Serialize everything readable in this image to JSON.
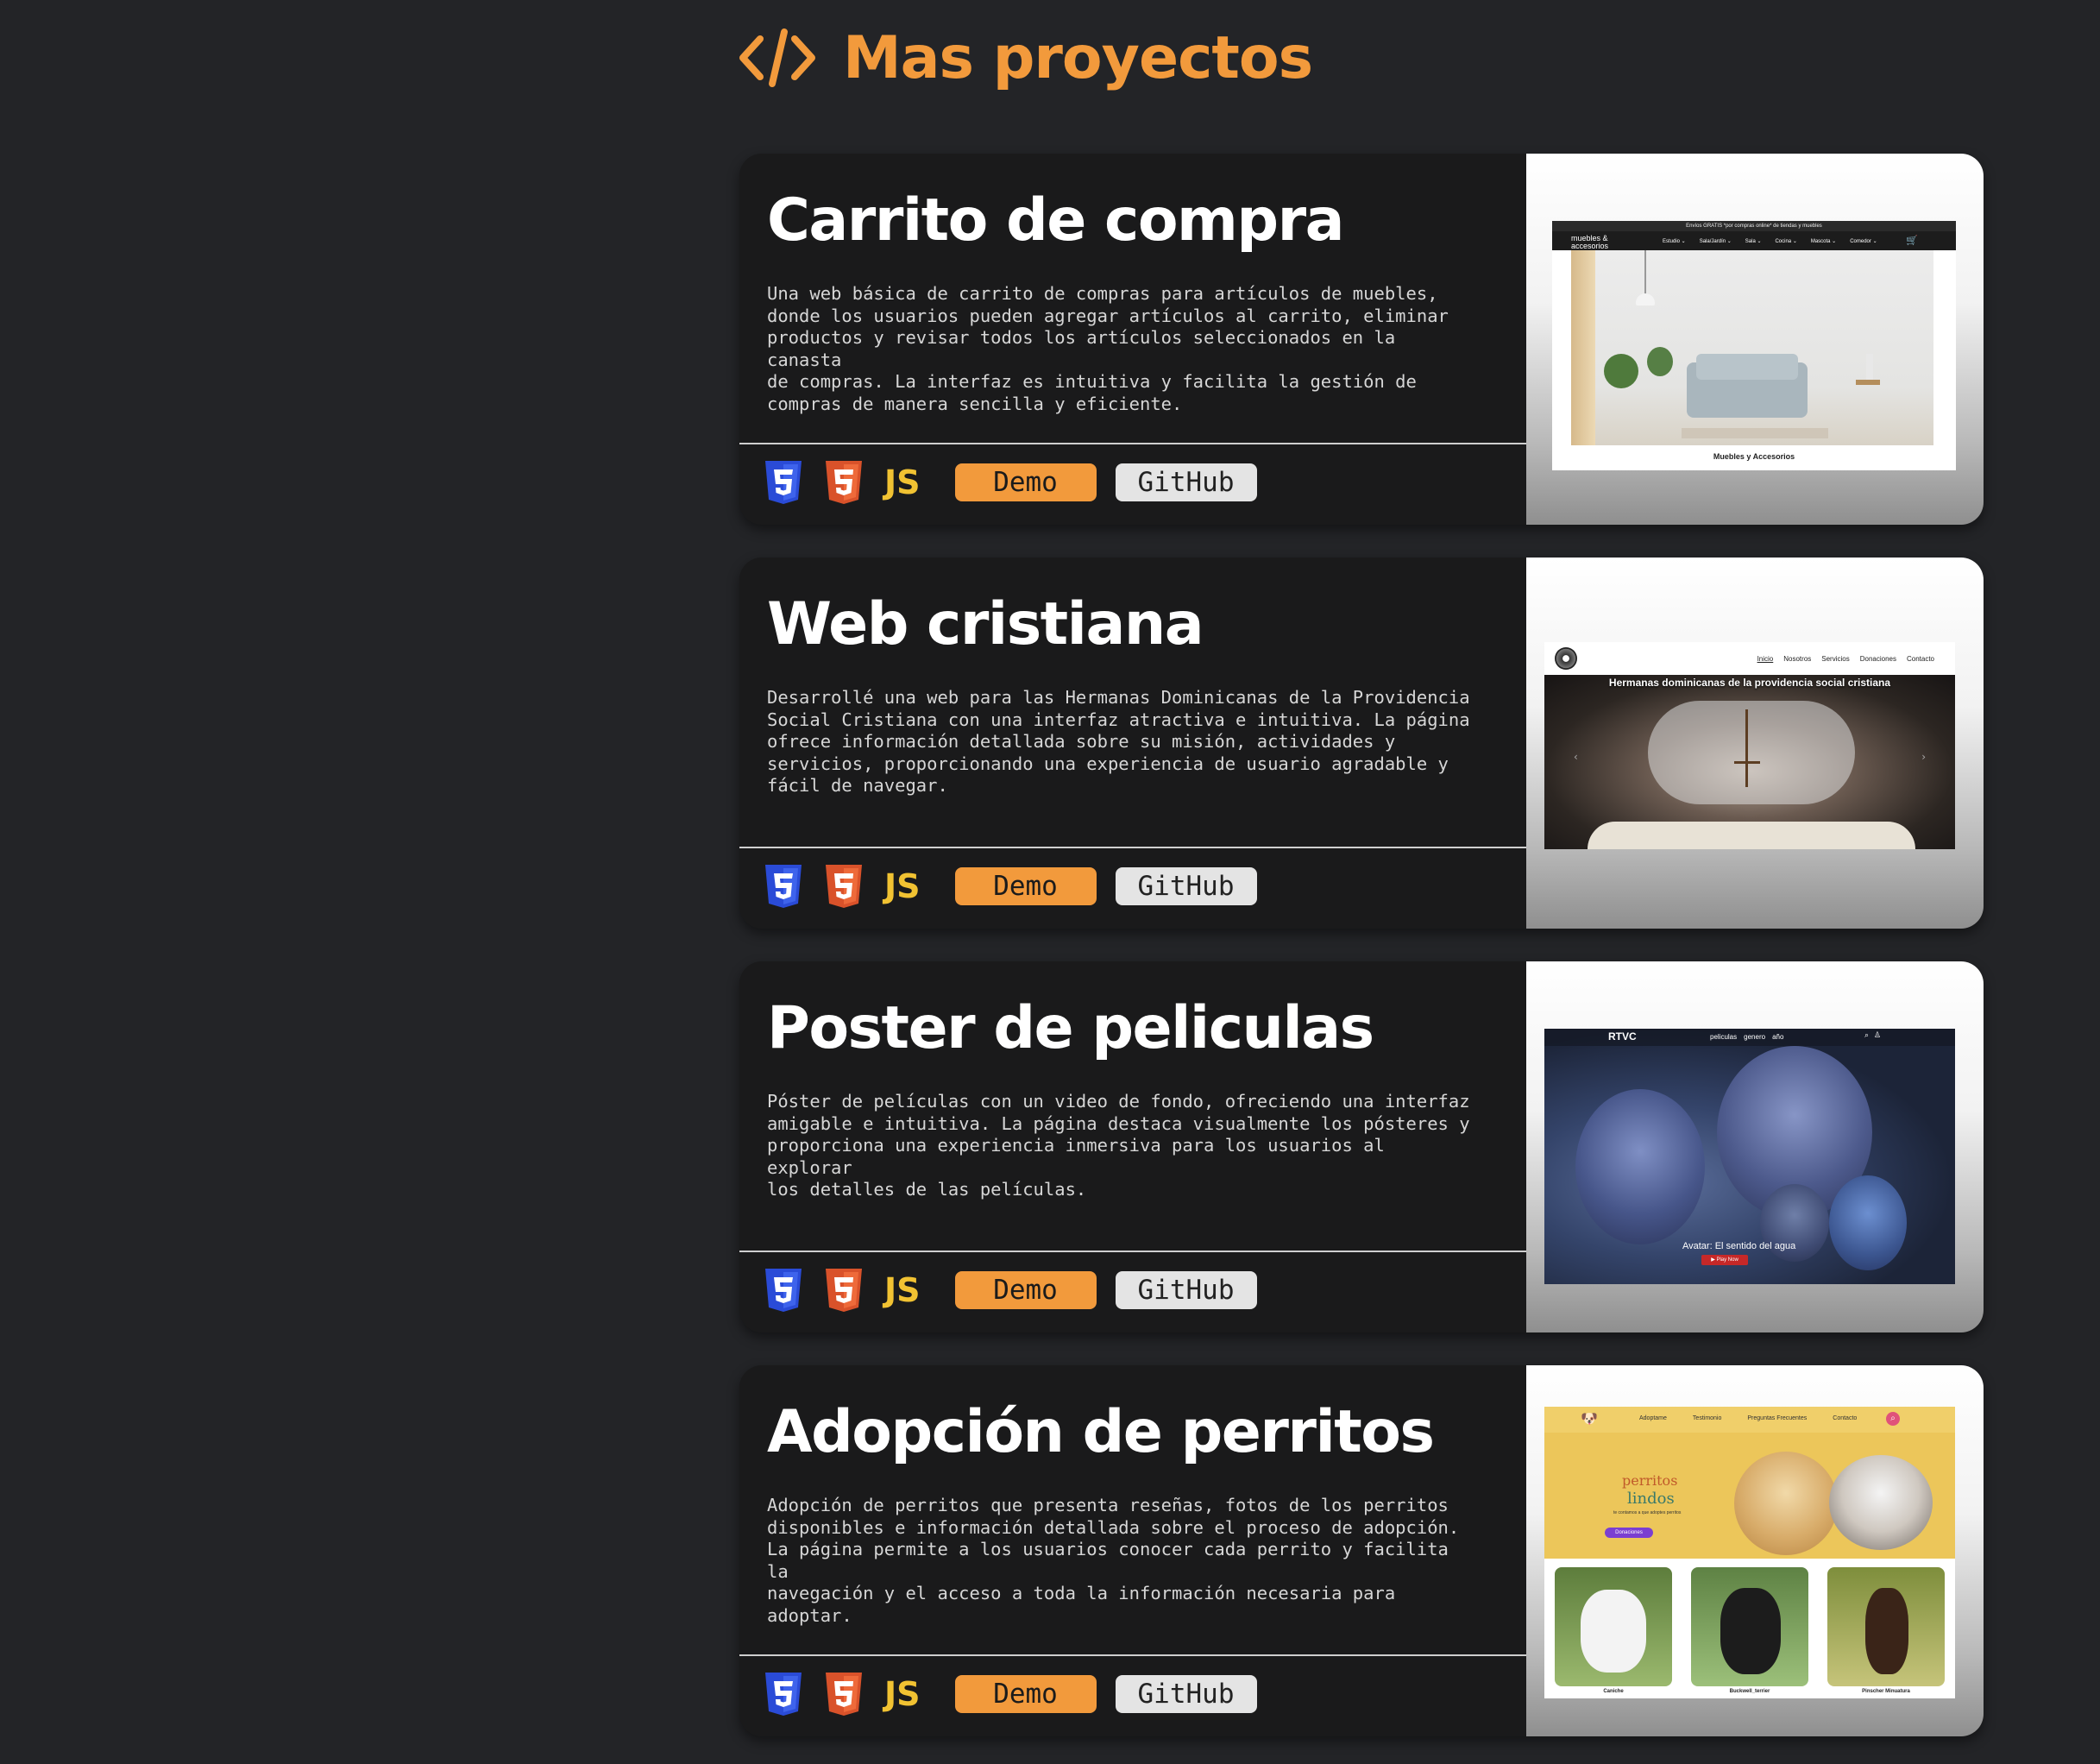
{
  "header": {
    "title": "Mas proyectos",
    "icon": "code-icon",
    "color": "#f29a3c"
  },
  "projects": [
    {
      "title": "Carrito de compra",
      "description": "Una web básica de carrito de compras para artículos de muebles,\ndonde los usuarios pueden agregar artículos al carrito, eliminar\nproductos y revisar todos los artículos seleccionados en la canasta\nde compras. La interfaz es intuitiva y facilita la gestión de\ncompras de manera sencilla y eficiente.",
      "tech": [
        "css3-icon",
        "html5-icon"
      ],
      "js_label": "JS",
      "demo_label": "Demo",
      "github_label": "GitHub",
      "preview": {
        "banner": "Envíos GRATIS *por compras online* de tiendas y muebles",
        "logo": "muebles & accesorios",
        "nav": [
          "Estudio ⌄",
          "Sala/Jardín ⌄",
          "Sala ⌄",
          "Cocina ⌄",
          "Mascota ⌄",
          "Comedor ⌄"
        ],
        "caption": "Muebles y Accesorios"
      }
    },
    {
      "title": "Web cristiana",
      "description": "Desarrollé una web para las Hermanas Dominicanas de la Providencia\nSocial Cristiana con una interfaz atractiva e intuitiva. La página\nofrece información detallada sobre su misión, actividades y\nservicios, proporcionando una experiencia de usuario agradable y\nfácil de navegar.",
      "tech": [
        "css3-icon",
        "html5-icon"
      ],
      "js_label": "JS",
      "demo_label": "Demo",
      "github_label": "GitHub",
      "preview": {
        "nav": [
          "Inicio",
          "Nosotros",
          "Servicios",
          "Donaciones",
          "Contacto"
        ],
        "hero_title": "Hermanas dominicanas de la providencia social cristiana"
      }
    },
    {
      "title": "Poster de peliculas",
      "description": "Póster de películas con un video de fondo, ofreciendo una interfaz\namigable e intuitiva. La página destaca visualmente los pósteres y\nproporciona una experiencia inmersiva para los usuarios al explorar\nlos detalles de las películas.",
      "tech": [
        "css3-icon",
        "html5-icon"
      ],
      "js_label": "JS",
      "demo_label": "Demo",
      "github_label": "GitHub",
      "preview": {
        "logo": "RTVC",
        "nav": [
          "peliculas",
          "genero",
          "año"
        ],
        "movie_title": "Avatar: El sentido del agua",
        "play_label": "▶ Play Now"
      }
    },
    {
      "title": "Adopción de perritos",
      "description": "Adopción de perritos que presenta reseñas, fotos de los perritos\ndisponibles e información detallada sobre el proceso de adopción.\nLa página permite a los usuarios conocer cada perrito y facilita la\nnavegación y el acceso a toda la información necesaria para\nadoptar.",
      "tech": [
        "css3-icon",
        "html5-icon"
      ],
      "js_label": "JS",
      "demo_label": "Demo",
      "github_label": "GitHub",
      "preview": {
        "nav": [
          "Adoptame",
          "Testimonio",
          "Preguntas Frecuentes",
          "Contacto"
        ],
        "brand_top": "perritos",
        "brand_bottom": "lindos",
        "tagline": "te contamos a que adoptes perritos",
        "cta": "Donaciones",
        "dogs": [
          "Caniche",
          "Buckwell_terrier",
          "Pinscher Minuatura"
        ]
      }
    }
  ]
}
